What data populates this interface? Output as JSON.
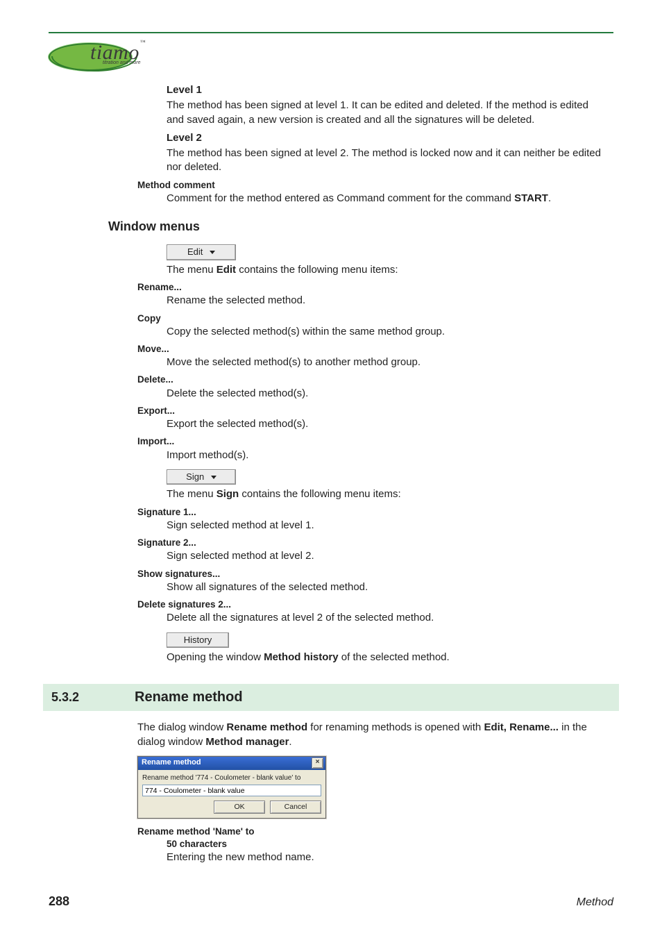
{
  "logo": {
    "brand": "tiamo",
    "tm": "™",
    "tagline": "titration and more"
  },
  "levels": {
    "level1_label": "Level 1",
    "level1_text": "The method has been signed at level 1. It can be edited and deleted. If the method is edited and saved again, a new version is created and all the signatures will be deleted.",
    "level2_label": "Level 2",
    "level2_text": "The method has been signed at level 2. The method is locked now and it can neither be edited nor deleted."
  },
  "method_comment": {
    "label": "Method comment",
    "text_a": "Comment for the method entered as Command comment for the command ",
    "text_b": "START",
    "text_c": "."
  },
  "window_menus_heading": "Window menus",
  "edit_menu": {
    "button": "Edit",
    "intro_a": "The menu ",
    "intro_b": "Edit",
    "intro_c": " contains the following menu items:",
    "items": [
      {
        "label": "Rename...",
        "desc": "Rename the selected method."
      },
      {
        "label": "Copy",
        "desc": "Copy the selected method(s) within the same method group."
      },
      {
        "label": "Move...",
        "desc": "Move the selected method(s) to another method group."
      },
      {
        "label": "Delete...",
        "desc": "Delete the selected method(s)."
      },
      {
        "label": "Export...",
        "desc": "Export the selected method(s)."
      },
      {
        "label": "Import...",
        "desc": "Import method(s)."
      }
    ]
  },
  "sign_menu": {
    "button": "Sign",
    "intro_a": "The menu ",
    "intro_b": "Sign",
    "intro_c": " contains the following menu items:",
    "items": [
      {
        "label": "Signature 1...",
        "desc": "Sign selected method at level 1."
      },
      {
        "label": "Signature 2...",
        "desc": "Sign selected method at level 2."
      },
      {
        "label": "Show signatures...",
        "desc": "Show all signatures of the selected method."
      },
      {
        "label": "Delete signatures 2...",
        "desc": "Delete all the signatures at level 2 of the selected method."
      }
    ]
  },
  "history": {
    "button": "History",
    "text_a": "Opening the window ",
    "text_b": "Method history",
    "text_c": " of the selected method."
  },
  "section": {
    "number": "5.3.2",
    "title": "Rename method"
  },
  "rename_intro": {
    "a": "The dialog window ",
    "b": "Rename method",
    "c": " for renaming methods is opened with ",
    "d": "Edit, Rename...",
    "e": " in the dialog window ",
    "f": "Method manager",
    "g": "."
  },
  "dialog": {
    "title": "Rename method",
    "label": "Rename method '774 - Coulometer - blank value' to",
    "value": "774 - Coulometer - blank value",
    "ok": "OK",
    "cancel": "Cancel"
  },
  "rename_field": {
    "label": "Rename method 'Name' to",
    "constraint": "50 characters",
    "desc": "Entering the new method name."
  },
  "footer": {
    "page": "288",
    "section": "Method"
  }
}
